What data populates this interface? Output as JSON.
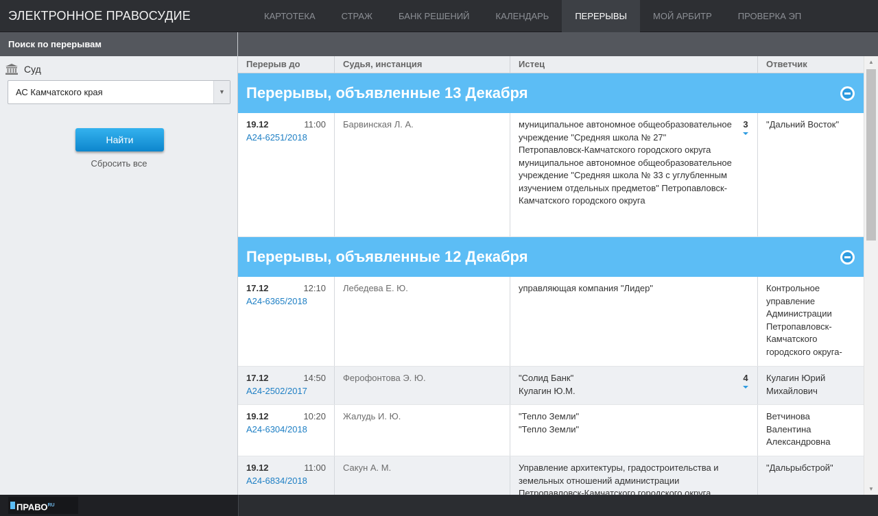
{
  "app": {
    "title": "ЭЛЕКТРОННОЕ ПРАВОСУДИЕ"
  },
  "nav": {
    "items": [
      {
        "label": "КАРТОТЕКА"
      },
      {
        "label": "СТРАЖ"
      },
      {
        "label": "БАНК РЕШЕНИЙ"
      },
      {
        "label": "КАЛЕНДАРЬ"
      },
      {
        "label": "ПЕРЕРЫВЫ"
      },
      {
        "label": "МОЙ АРБИТР"
      },
      {
        "label": "ПРОВЕРКА ЭП"
      }
    ],
    "active_index": 4
  },
  "sidebar": {
    "title": "Поиск по перерывам",
    "court_label": "Суд",
    "court_value": "АС Камчатского края",
    "find_label": "Найти",
    "reset_label": "Сбросить все"
  },
  "table": {
    "columns": [
      "Перерыв до",
      "Судья, инстанция",
      "Истец",
      "Ответчик"
    ],
    "groups": [
      {
        "title": "Перерывы, объявленные 13 Декабря",
        "rows": [
          {
            "date": "19.12",
            "time": "11:00",
            "case": "А24-6251/2018",
            "judge": "Барвинская Л. А.",
            "plaintiff": "муниципальное автономное общеобразовательное учреждение \"Средняя школа № 27\" Петропавловск-Камчатского городского округа\nмуниципальное автономное общеобразовательное учреждение \"Средняя школа № 33 с углубленным изучением отдельных предметов\" Петропавловск-Камчатского городского округа",
            "count": "3",
            "defendant": "\"Дальний Восток\""
          }
        ]
      },
      {
        "title": "Перерывы, объявленные 12 Декабря",
        "rows": [
          {
            "date": "17.12",
            "time": "12:10",
            "case": "А24-6365/2018",
            "judge": "Лебедева Е. Ю.",
            "plaintiff": "управляющая компания \"Лидер\"",
            "count": "",
            "defendant": "Контрольное управление Администрации Петропавловск-Камчатского городского округа-"
          },
          {
            "date": "17.12",
            "time": "14:50",
            "case": "А24-2502/2017",
            "judge": "Ферофонтова Э. Ю.",
            "plaintiff": "\"Солид Банк\"\nКулагин Ю.М.",
            "count": "4",
            "defendant": "Кулагин Юрий Михайлович"
          },
          {
            "date": "19.12",
            "time": "10:20",
            "case": "А24-6304/2018",
            "judge": "Жалудь И. Ю.",
            "plaintiff": "\"Тепло Земли\"\n\"Тепло Земли\"",
            "count": "",
            "defendant": "Ветчинова Валентина Александровна"
          },
          {
            "date": "19.12",
            "time": "11:00",
            "case": "А24-6834/2018",
            "judge": "Сакун А. М.",
            "plaintiff": "Управление архитектуры, градостроительства и земельных отношений администрации Петропавловск-Камчатского городского округа",
            "count": "",
            "defendant": "\"Дальрыбстрой\""
          }
        ]
      }
    ]
  },
  "footer": {
    "logo": "ПРАВО",
    "logo_sup": "RU"
  },
  "colors": {
    "accent": "#5cbdf5",
    "button": "#1a97dc",
    "link": "#1e7fc4",
    "topbar": "#2d2f33"
  }
}
